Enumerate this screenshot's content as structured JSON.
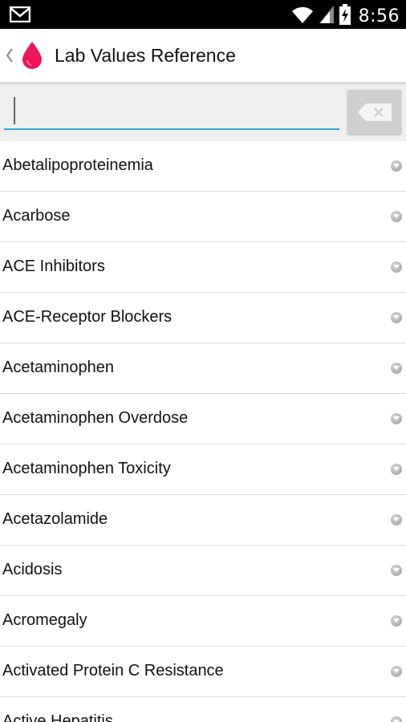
{
  "status_bar": {
    "time": "8:56",
    "icons": [
      "gmail-icon",
      "wifi-icon",
      "signal-icon",
      "battery-charging-icon"
    ]
  },
  "action_bar": {
    "title": "Lab Values Reference",
    "logo_icon": "blood-drop-icon",
    "logo_color": "#f0145a"
  },
  "search": {
    "value": "",
    "placeholder": "",
    "clear_icon": "backspace-clear-icon",
    "underline_color": "#31a8d8"
  },
  "list": {
    "items": [
      {
        "label": "Abetalipoproteinemia"
      },
      {
        "label": "Acarbose"
      },
      {
        "label": "ACE Inhibitors"
      },
      {
        "label": "ACE-Receptor Blockers"
      },
      {
        "label": "Acetaminophen"
      },
      {
        "label": "Acetaminophen Overdose"
      },
      {
        "label": "Acetaminophen Toxicity"
      },
      {
        "label": "Acetazolamide"
      },
      {
        "label": "Acidosis"
      },
      {
        "label": "Acromegaly"
      },
      {
        "label": "Activated Protein C Resistance"
      },
      {
        "label": "Active Hepatitis"
      }
    ],
    "item_icon": "expand-arrow-icon"
  }
}
